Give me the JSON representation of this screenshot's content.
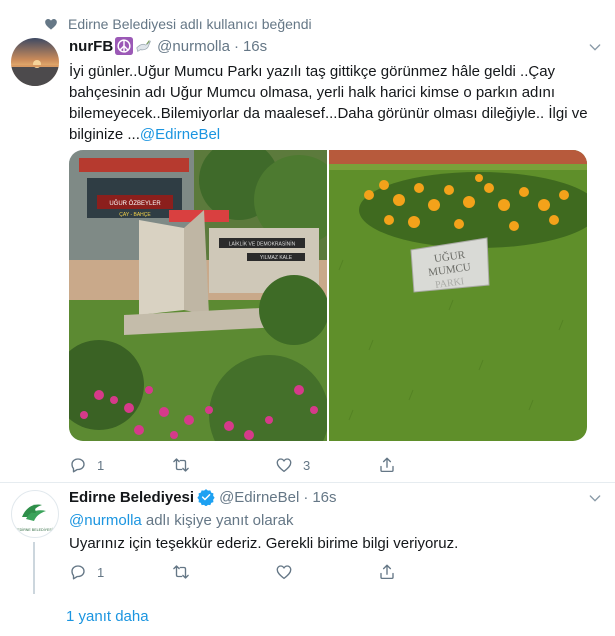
{
  "social_context": {
    "text": "Edirne Belediyesi adlı kullanıcı beğendi"
  },
  "tweet": {
    "display_name": "nurFB",
    "handle": "@nurmolla",
    "separator": "·",
    "time": "16s",
    "text_main": "İyi günler..Uğur Mumcu Parkı yazılı taş gittikçe görünmez hâle geldi ..Çay bahçesinin adı Uğur Mumcu olmasa, yerli halk harici kimse o parkın adını bilemeyecek..Bilemiyorlar da maalesef...Daha görünür olması dileğiyle.. İlgi ve bilginize ...",
    "mention": "@EdirneBel",
    "images": {
      "left": {
        "sign_cafe": "UĞUR ÖZBEYLER",
        "sign_sub": "ÇAY - BAHÇE",
        "plaque1": "LAİKLİK VE DEMOKRASİNİN",
        "plaque2": "YILMAZ KALE"
      },
      "right": {
        "stone_line1": "UĞUR",
        "stone_line2": "MUMCU",
        "stone_line3": "PARKI"
      }
    },
    "actions": {
      "reply_count": "1",
      "retweet_count": "",
      "like_count": "3"
    }
  },
  "reply": {
    "display_name": "Edirne Belediyesi",
    "handle": "@EdirneBel",
    "separator": "·",
    "time": "16s",
    "reply_to_mention": "@nurmolla",
    "reply_to_suffix": " adlı kişiye yanıt olarak",
    "text": "Uyarınız için teşekkür ederiz. Gerekli birime bilgi veriyoruz.",
    "avatar_text": "EDİRNE BELEDİYESİ",
    "actions": {
      "reply_count": "1",
      "retweet_count": "",
      "like_count": ""
    }
  },
  "more_replies": "1 yanıt daha",
  "colors": {
    "link": "#1b95e0",
    "muted": "#657786",
    "verified": "#1da1f2",
    "divider": "#e6ecf0"
  }
}
